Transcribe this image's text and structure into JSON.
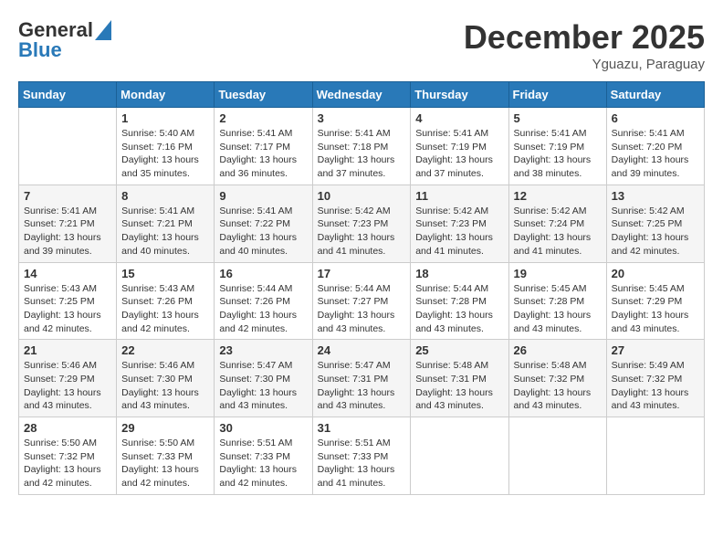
{
  "header": {
    "logo_line1": "General",
    "logo_line2": "Blue",
    "month_title": "December 2025",
    "subtitle": "Yguazu, Paraguay"
  },
  "days_of_week": [
    "Sunday",
    "Monday",
    "Tuesday",
    "Wednesday",
    "Thursday",
    "Friday",
    "Saturday"
  ],
  "weeks": [
    [
      {
        "num": "",
        "sunrise": "",
        "sunset": "",
        "daylight": ""
      },
      {
        "num": "1",
        "sunrise": "Sunrise: 5:40 AM",
        "sunset": "Sunset: 7:16 PM",
        "daylight": "Daylight: 13 hours and 35 minutes."
      },
      {
        "num": "2",
        "sunrise": "Sunrise: 5:41 AM",
        "sunset": "Sunset: 7:17 PM",
        "daylight": "Daylight: 13 hours and 36 minutes."
      },
      {
        "num": "3",
        "sunrise": "Sunrise: 5:41 AM",
        "sunset": "Sunset: 7:18 PM",
        "daylight": "Daylight: 13 hours and 37 minutes."
      },
      {
        "num": "4",
        "sunrise": "Sunrise: 5:41 AM",
        "sunset": "Sunset: 7:19 PM",
        "daylight": "Daylight: 13 hours and 37 minutes."
      },
      {
        "num": "5",
        "sunrise": "Sunrise: 5:41 AM",
        "sunset": "Sunset: 7:19 PM",
        "daylight": "Daylight: 13 hours and 38 minutes."
      },
      {
        "num": "6",
        "sunrise": "Sunrise: 5:41 AM",
        "sunset": "Sunset: 7:20 PM",
        "daylight": "Daylight: 13 hours and 39 minutes."
      }
    ],
    [
      {
        "num": "7",
        "sunrise": "Sunrise: 5:41 AM",
        "sunset": "Sunset: 7:21 PM",
        "daylight": "Daylight: 13 hours and 39 minutes."
      },
      {
        "num": "8",
        "sunrise": "Sunrise: 5:41 AM",
        "sunset": "Sunset: 7:21 PM",
        "daylight": "Daylight: 13 hours and 40 minutes."
      },
      {
        "num": "9",
        "sunrise": "Sunrise: 5:41 AM",
        "sunset": "Sunset: 7:22 PM",
        "daylight": "Daylight: 13 hours and 40 minutes."
      },
      {
        "num": "10",
        "sunrise": "Sunrise: 5:42 AM",
        "sunset": "Sunset: 7:23 PM",
        "daylight": "Daylight: 13 hours and 41 minutes."
      },
      {
        "num": "11",
        "sunrise": "Sunrise: 5:42 AM",
        "sunset": "Sunset: 7:23 PM",
        "daylight": "Daylight: 13 hours and 41 minutes."
      },
      {
        "num": "12",
        "sunrise": "Sunrise: 5:42 AM",
        "sunset": "Sunset: 7:24 PM",
        "daylight": "Daylight: 13 hours and 41 minutes."
      },
      {
        "num": "13",
        "sunrise": "Sunrise: 5:42 AM",
        "sunset": "Sunset: 7:25 PM",
        "daylight": "Daylight: 13 hours and 42 minutes."
      }
    ],
    [
      {
        "num": "14",
        "sunrise": "Sunrise: 5:43 AM",
        "sunset": "Sunset: 7:25 PM",
        "daylight": "Daylight: 13 hours and 42 minutes."
      },
      {
        "num": "15",
        "sunrise": "Sunrise: 5:43 AM",
        "sunset": "Sunset: 7:26 PM",
        "daylight": "Daylight: 13 hours and 42 minutes."
      },
      {
        "num": "16",
        "sunrise": "Sunrise: 5:44 AM",
        "sunset": "Sunset: 7:26 PM",
        "daylight": "Daylight: 13 hours and 42 minutes."
      },
      {
        "num": "17",
        "sunrise": "Sunrise: 5:44 AM",
        "sunset": "Sunset: 7:27 PM",
        "daylight": "Daylight: 13 hours and 43 minutes."
      },
      {
        "num": "18",
        "sunrise": "Sunrise: 5:44 AM",
        "sunset": "Sunset: 7:28 PM",
        "daylight": "Daylight: 13 hours and 43 minutes."
      },
      {
        "num": "19",
        "sunrise": "Sunrise: 5:45 AM",
        "sunset": "Sunset: 7:28 PM",
        "daylight": "Daylight: 13 hours and 43 minutes."
      },
      {
        "num": "20",
        "sunrise": "Sunrise: 5:45 AM",
        "sunset": "Sunset: 7:29 PM",
        "daylight": "Daylight: 13 hours and 43 minutes."
      }
    ],
    [
      {
        "num": "21",
        "sunrise": "Sunrise: 5:46 AM",
        "sunset": "Sunset: 7:29 PM",
        "daylight": "Daylight: 13 hours and 43 minutes."
      },
      {
        "num": "22",
        "sunrise": "Sunrise: 5:46 AM",
        "sunset": "Sunset: 7:30 PM",
        "daylight": "Daylight: 13 hours and 43 minutes."
      },
      {
        "num": "23",
        "sunrise": "Sunrise: 5:47 AM",
        "sunset": "Sunset: 7:30 PM",
        "daylight": "Daylight: 13 hours and 43 minutes."
      },
      {
        "num": "24",
        "sunrise": "Sunrise: 5:47 AM",
        "sunset": "Sunset: 7:31 PM",
        "daylight": "Daylight: 13 hours and 43 minutes."
      },
      {
        "num": "25",
        "sunrise": "Sunrise: 5:48 AM",
        "sunset": "Sunset: 7:31 PM",
        "daylight": "Daylight: 13 hours and 43 minutes."
      },
      {
        "num": "26",
        "sunrise": "Sunrise: 5:48 AM",
        "sunset": "Sunset: 7:32 PM",
        "daylight": "Daylight: 13 hours and 43 minutes."
      },
      {
        "num": "27",
        "sunrise": "Sunrise: 5:49 AM",
        "sunset": "Sunset: 7:32 PM",
        "daylight": "Daylight: 13 hours and 43 minutes."
      }
    ],
    [
      {
        "num": "28",
        "sunrise": "Sunrise: 5:50 AM",
        "sunset": "Sunset: 7:32 PM",
        "daylight": "Daylight: 13 hours and 42 minutes."
      },
      {
        "num": "29",
        "sunrise": "Sunrise: 5:50 AM",
        "sunset": "Sunset: 7:33 PM",
        "daylight": "Daylight: 13 hours and 42 minutes."
      },
      {
        "num": "30",
        "sunrise": "Sunrise: 5:51 AM",
        "sunset": "Sunset: 7:33 PM",
        "daylight": "Daylight: 13 hours and 42 minutes."
      },
      {
        "num": "31",
        "sunrise": "Sunrise: 5:51 AM",
        "sunset": "Sunset: 7:33 PM",
        "daylight": "Daylight: 13 hours and 41 minutes."
      },
      {
        "num": "",
        "sunrise": "",
        "sunset": "",
        "daylight": ""
      },
      {
        "num": "",
        "sunrise": "",
        "sunset": "",
        "daylight": ""
      },
      {
        "num": "",
        "sunrise": "",
        "sunset": "",
        "daylight": ""
      }
    ]
  ]
}
